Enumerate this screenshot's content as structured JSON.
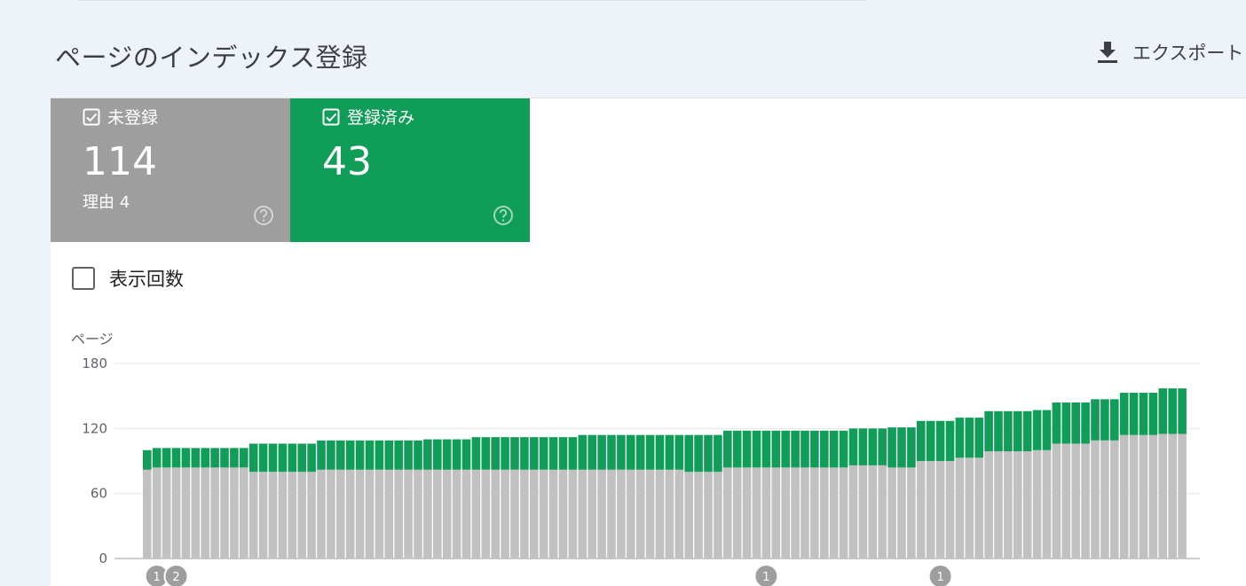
{
  "header": {
    "title": "ページのインデックス登録",
    "export_label": "エクスポート"
  },
  "cards": {
    "not_indexed": {
      "label": "未登録",
      "count": "114",
      "sub": "理由 4"
    },
    "indexed": {
      "label": "登録済み",
      "count": "43"
    }
  },
  "impressions": {
    "label": "表示回数"
  },
  "chart_data": {
    "type": "bar",
    "stacked": true,
    "ylabel": "ページ",
    "ylim": [
      0,
      180
    ],
    "yticks": [
      0,
      60,
      120,
      180
    ],
    "grid": true,
    "colors": {
      "not_indexed": "#c1c1c1",
      "indexed": "#0f9d58"
    },
    "series": [
      {
        "name": "未登録",
        "values": [
          82,
          84,
          84,
          84,
          84,
          84,
          84,
          84,
          84,
          84,
          84,
          80,
          80,
          80,
          80,
          80,
          80,
          80,
          82,
          82,
          82,
          82,
          82,
          82,
          82,
          82,
          82,
          82,
          82,
          82,
          82,
          82,
          82,
          82,
          82,
          82,
          82,
          82,
          82,
          82,
          82,
          82,
          82,
          82,
          82,
          82,
          82,
          82,
          82,
          82,
          82,
          82,
          82,
          82,
          82,
          82,
          80,
          80,
          80,
          80,
          84,
          84,
          84,
          84,
          84,
          84,
          84,
          84,
          84,
          84,
          84,
          84,
          84,
          86,
          86,
          86,
          86,
          84,
          84,
          84,
          90,
          90,
          90,
          90,
          93,
          93,
          93,
          99,
          99,
          99,
          99,
          99,
          100,
          100,
          106,
          106,
          106,
          106,
          109,
          109,
          109,
          114,
          114,
          114,
          114,
          115,
          115,
          115
        ]
      },
      {
        "name": "登録済み",
        "values": [
          18,
          18,
          18,
          18,
          18,
          18,
          18,
          18,
          18,
          18,
          18,
          26,
          26,
          26,
          26,
          26,
          26,
          26,
          27,
          27,
          27,
          27,
          27,
          27,
          27,
          27,
          27,
          27,
          27,
          28,
          28,
          28,
          28,
          28,
          30,
          30,
          30,
          30,
          30,
          30,
          30,
          30,
          30,
          30,
          30,
          32,
          32,
          32,
          32,
          32,
          32,
          32,
          32,
          32,
          32,
          32,
          34,
          34,
          34,
          34,
          34,
          34,
          34,
          34,
          34,
          34,
          34,
          34,
          34,
          34,
          34,
          34,
          34,
          34,
          34,
          34,
          34,
          37,
          37,
          37,
          37,
          37,
          37,
          37,
          37,
          37,
          37,
          37,
          37,
          37,
          37,
          37,
          37,
          37,
          38,
          38,
          38,
          38,
          38,
          38,
          38,
          39,
          39,
          39,
          39,
          42,
          42,
          42
        ]
      }
    ],
    "annotations": [
      {
        "index": 1,
        "label": "1"
      },
      {
        "index": 3,
        "label": "2"
      },
      {
        "index": 64,
        "label": "1"
      },
      {
        "index": 82,
        "label": "1"
      }
    ]
  },
  "icons": {
    "export": "download-icon",
    "card_check": "checkbox-checked-icon",
    "help": "help-circle-icon"
  }
}
